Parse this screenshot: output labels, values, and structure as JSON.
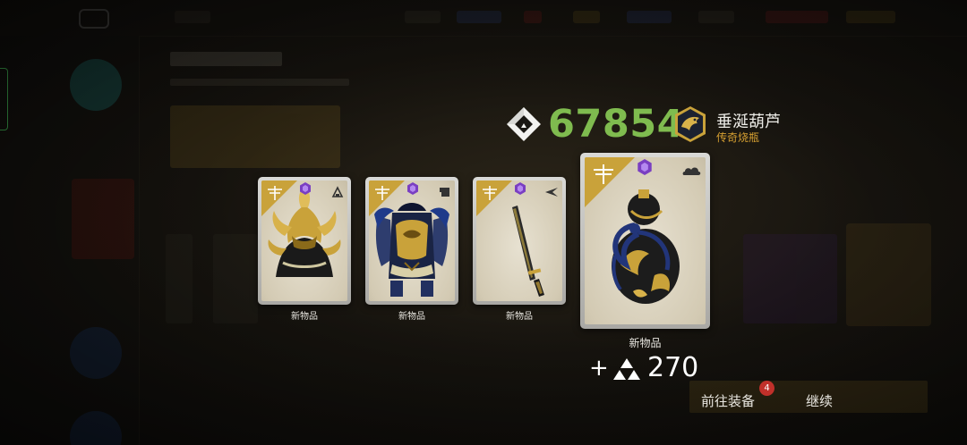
{
  "reward": {
    "credits_icon": "helix-credits-icon",
    "credits_value": "67854",
    "title_emblem": "crow-emblem-icon",
    "title_name": "垂涎葫芦",
    "title_subtitle": "传奇烧瓶"
  },
  "cards": [
    {
      "label": "新物品",
      "art": "golden-helmet",
      "type_icon": "helmet-type-icon"
    },
    {
      "label": "新物品",
      "art": "blue-samurai-armor",
      "type_icon": "armor-type-icon"
    },
    {
      "label": "新物品",
      "art": "katana",
      "type_icon": "melee-weapon-type-icon"
    },
    {
      "label": "新物品",
      "art": "black-gold-gourd",
      "type_icon": "flask-type-icon"
    }
  ],
  "card_corner_icon": "dragonfly-icon",
  "rarity_icon": "purple-legendary-gem-icon",
  "bonus": {
    "prefix": "+",
    "icon": "supplies-triangle-icon",
    "value": "270"
  },
  "actions": {
    "go_equip_label": "前往装备",
    "go_equip_badge": "4",
    "continue_label": "继续"
  },
  "colors": {
    "credits": "#7fbb4f",
    "subtitle_gold": "#d6a032",
    "card_corner_gold": "#c9a23a",
    "rarity_purple": "#7a3fc2",
    "badge_red": "#c0302a"
  }
}
